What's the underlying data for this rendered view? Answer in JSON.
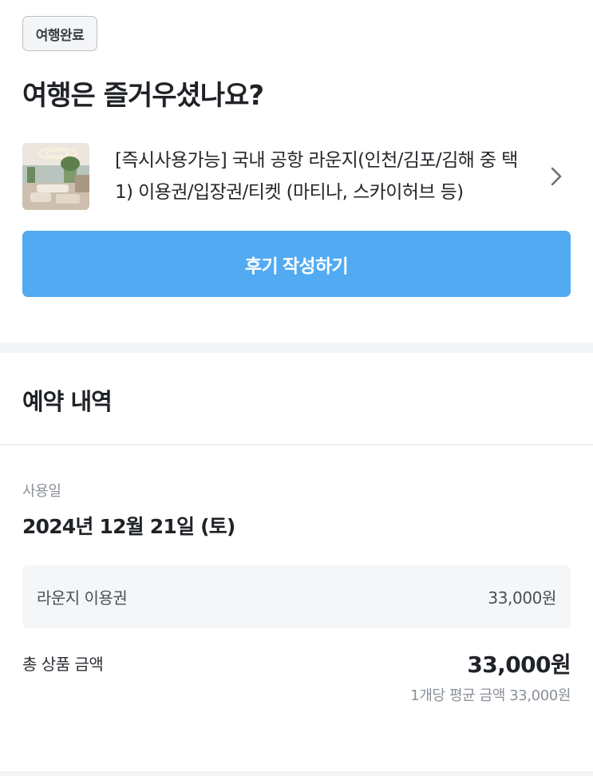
{
  "header": {
    "status_badge": "여행완료",
    "title": "여행은 즐거우셨나요?"
  },
  "product": {
    "name": "[즉시사용가능] 국내 공항 라운지(인천/김포/김해 중 택1) 이용권/입장권/티켓 (마티나, 스카이허브 등)",
    "chevron_icon": "chevron-right-icon"
  },
  "actions": {
    "review_label": "후기 작성하기",
    "review_color": "#52aaf2"
  },
  "reservation": {
    "section_title": "예약 내역",
    "usage_label": "사용일",
    "usage_date": "2024년 12월 21일 (토)",
    "items": [
      {
        "name": "라운지 이용권",
        "price": "33,000원"
      }
    ],
    "total_label": "총 상품 금액",
    "total_amount": "33,000원",
    "average_price": "1개당 평균 금액 33,000원"
  }
}
